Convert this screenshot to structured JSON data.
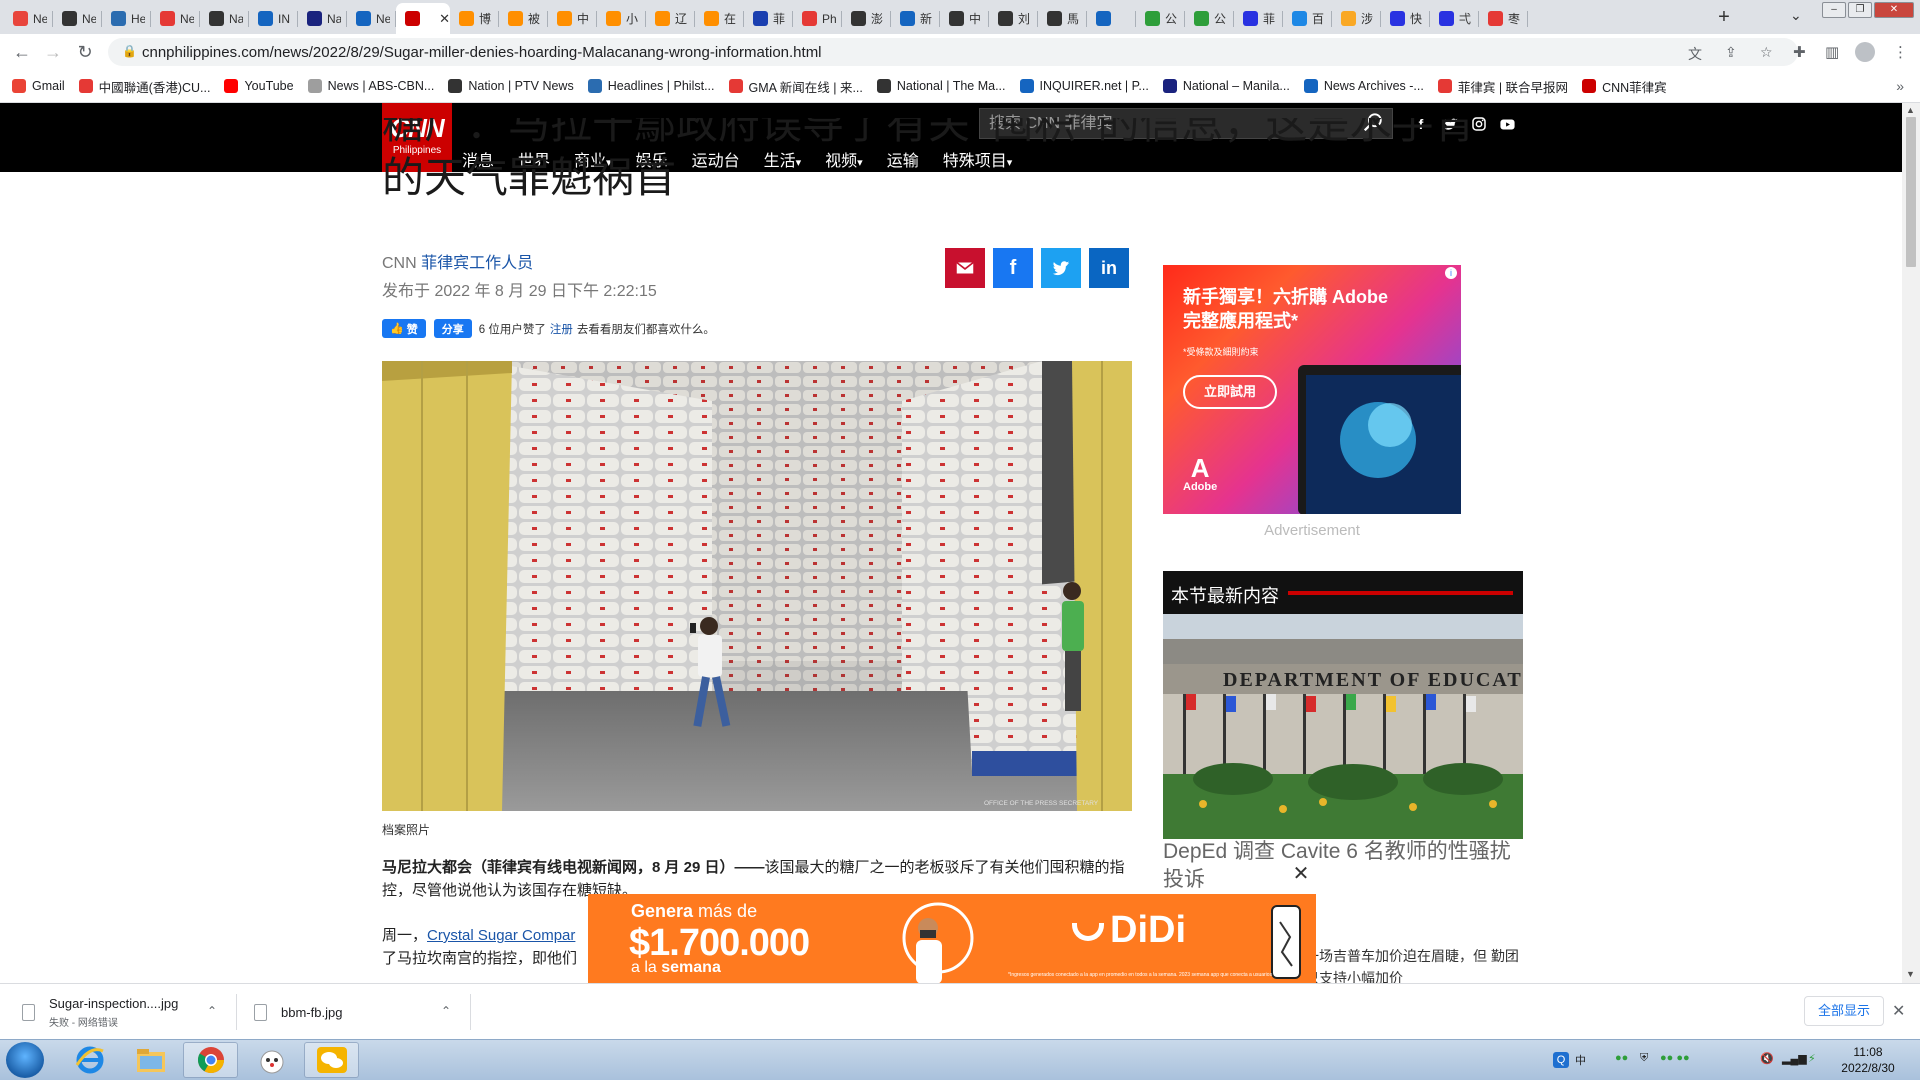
{
  "browser": {
    "tabs": [
      {
        "title": "Ne",
        "icon": "news-icon",
        "color": "#e8453c"
      },
      {
        "title": "Ne",
        "icon": "play-icon",
        "color": "#333333"
      },
      {
        "title": "He",
        "icon": "philstar-icon",
        "color": "#2b6cb0"
      },
      {
        "title": "Ne",
        "icon": "gma-icon",
        "color": "#e53935"
      },
      {
        "title": "Na",
        "icon": "manila-times-icon",
        "color": "#333333"
      },
      {
        "title": "IN",
        "icon": "inquirer-icon",
        "color": "#1565c0"
      },
      {
        "title": "Na",
        "icon": "mb-icon",
        "color": "#1a237e"
      },
      {
        "title": "Ne",
        "icon": "news-archives-icon",
        "color": "#1565c0"
      },
      {
        "title": "",
        "icon": "cnn-icon",
        "color": "#cc0000",
        "active": true
      },
      {
        "title": "博",
        "icon": "weibo-icon",
        "color": "#ff8f00"
      },
      {
        "title": "被",
        "icon": "weibo-icon",
        "color": "#ff8f00"
      },
      {
        "title": "中",
        "icon": "weibo-icon",
        "color": "#ff8f00"
      },
      {
        "title": "小",
        "icon": "weibo-icon",
        "color": "#ff8f00"
      },
      {
        "title": "辽",
        "icon": "weibo-icon",
        "color": "#ff8f00"
      },
      {
        "title": "在",
        "icon": "weibo-icon",
        "color": "#ff8f00"
      },
      {
        "title": "菲",
        "icon": "globe-icon",
        "color": "#1a3fb0"
      },
      {
        "title": "Ph",
        "icon": "ph-icon",
        "color": "#e53935"
      },
      {
        "title": "澎",
        "icon": "pengpai-icon",
        "color": "#333333"
      },
      {
        "title": "新",
        "icon": "news-archives-icon",
        "color": "#1565c0"
      },
      {
        "title": "中",
        "icon": "github-icon",
        "color": "#333333"
      },
      {
        "title": "刘",
        "icon": "github-icon",
        "color": "#333333"
      },
      {
        "title": "馬",
        "icon": "github-icon",
        "color": "#333333"
      },
      {
        "title": "",
        "icon": "app-icon",
        "color": "#1565c0"
      },
      {
        "title": "公",
        "icon": "wechat-icon",
        "color": "#2e9e3a"
      },
      {
        "title": "公",
        "icon": "wechat-icon",
        "color": "#2e9e3a"
      },
      {
        "title": "菲",
        "icon": "baidu-icon",
        "color": "#2932e1"
      },
      {
        "title": "百",
        "icon": "translate-icon",
        "color": "#1e88e5"
      },
      {
        "title": "涉",
        "icon": "sina-icon",
        "color": "#f9a825"
      },
      {
        "title": "快",
        "icon": "baidu-icon",
        "color": "#2932e1"
      },
      {
        "title": "弌",
        "icon": "baidu-icon",
        "color": "#2932e1"
      },
      {
        "title": "枣",
        "icon": "lianhe-icon",
        "color": "#e53935"
      }
    ],
    "url": "cnnphilippines.com/news/2022/8/29/Sugar-miller-denies-hoarding-Malacanang-wrong-information.html",
    "bookmarks": [
      {
        "label": "Gmail",
        "icon": "gmail-icon",
        "color": "#ea4335"
      },
      {
        "label": "中國聯通(香港)CU...",
        "icon": "sg-icon",
        "color": "#e53935"
      },
      {
        "label": "YouTube",
        "icon": "youtube-icon",
        "color": "#ff0000"
      },
      {
        "label": "News | ABS-CBN...",
        "icon": "abscbn-icon",
        "color": "#9e9e9e"
      },
      {
        "label": "Nation | PTV News",
        "icon": "ptv-icon",
        "color": "#333333"
      },
      {
        "label": "Headlines | Philst...",
        "icon": "philstar-icon",
        "color": "#2b6cb0"
      },
      {
        "label": "GMA 新闻在线 | 来...",
        "icon": "gma-icon",
        "color": "#e53935"
      },
      {
        "label": "National | The Ma...",
        "icon": "manila-times-icon",
        "color": "#333333"
      },
      {
        "label": "INQUIRER.net | P...",
        "icon": "inquirer-icon",
        "color": "#1565c0"
      },
      {
        "label": "National – Manila...",
        "icon": "mb-icon",
        "color": "#1a237e"
      },
      {
        "label": "News Archives -...",
        "icon": "news-archives-icon",
        "color": "#1565c0"
      },
      {
        "label": "菲律宾 | 联合早报网",
        "icon": "lianhe-icon",
        "color": "#e53935"
      },
      {
        "label": "CNN菲律宾",
        "icon": "cnn-icon",
        "color": "#cc0000"
      }
    ]
  },
  "site": {
    "logo_big": "CNN",
    "logo_small": "Philippines",
    "nav": [
      "消息",
      "世界",
      "商业",
      "娱乐",
      "运动台",
      "生活",
      "视频",
      "运输",
      "特殊项目"
    ],
    "nav_dropdown": [
      false,
      false,
      true,
      false,
      false,
      true,
      true,
      false,
      true
    ],
    "search_placeholder": "搜索 CNN 菲律宾",
    "social": [
      "facebook-icon",
      "twitter-icon",
      "instagram-icon",
      "youtube-icon"
    ]
  },
  "article": {
    "headline_clipped": "糖厂：马拉干鄢政府误导了有关“囤积”的信息，这是水手背后",
    "headline_line2": "的天气罪魁祸首",
    "byline_prefix": "CNN ",
    "byline_author": "菲律宾工作人员",
    "pubdate": "发布于 2022 年 8 月 29 日下午 2:22:15",
    "fb_like": "赞",
    "fb_share": "分享",
    "fb_count_text": "6 位用户赞了",
    "fb_signup": "注册",
    "fb_rest": "去看看朋友们都喜欢什么。",
    "photo_credit": "OFFICE OF THE PRESS SECRETARY",
    "caption": "档案照片",
    "lead_bold": "马尼拉大都会（菲律宾有线电视新闻网，8 月 29 日）——",
    "lead_text": "该国最大的糖厂之一的老板驳斥了有关他们囤积糖的指控，尽管他说他认为该国存在糖短缺。",
    "para2_start": "周一，",
    "para2_link": "Crystal Sugar Compar",
    "para2_line2": "了马拉坎南宫的指控，即他们"
  },
  "sidebar": {
    "ad_title": "新手獨享！六折購 Adobe完整應用程式*",
    "ad_sub": "*受條款及細則約束",
    "ad_cta": "立即試用",
    "ad_brand": "Adobe",
    "ad_label": "Advertisement",
    "section_title": "本节最新内容",
    "news_title": "DepEd 调查 Cavite 6 名教师的性骚扰投诉",
    "side_para": "一场吉普车加价迫在眉睫，但 勤团只支持小幅加价"
  },
  "overlay_ad": {
    "line1_a": "Genera",
    "line1_b": " más de",
    "line2": "$1.700.000",
    "line3_a": "a la ",
    "line3_b": "semana",
    "brand": "DiDi",
    "legal": "*Ingresos generados conectado a la app en promedio en todos a la semana. 2023 semana app que conecta a usuarios con Bodas."
  },
  "downloads": [
    {
      "name": "Sugar-inspection....jpg",
      "status": "失败 - 网络错误"
    },
    {
      "name": "bbm-fb.jpg",
      "status": ""
    }
  ],
  "shelf": {
    "show_all": "全部显示"
  },
  "taskbar": {
    "time": "11:08",
    "date": "2022/8/30",
    "ime": "中"
  }
}
